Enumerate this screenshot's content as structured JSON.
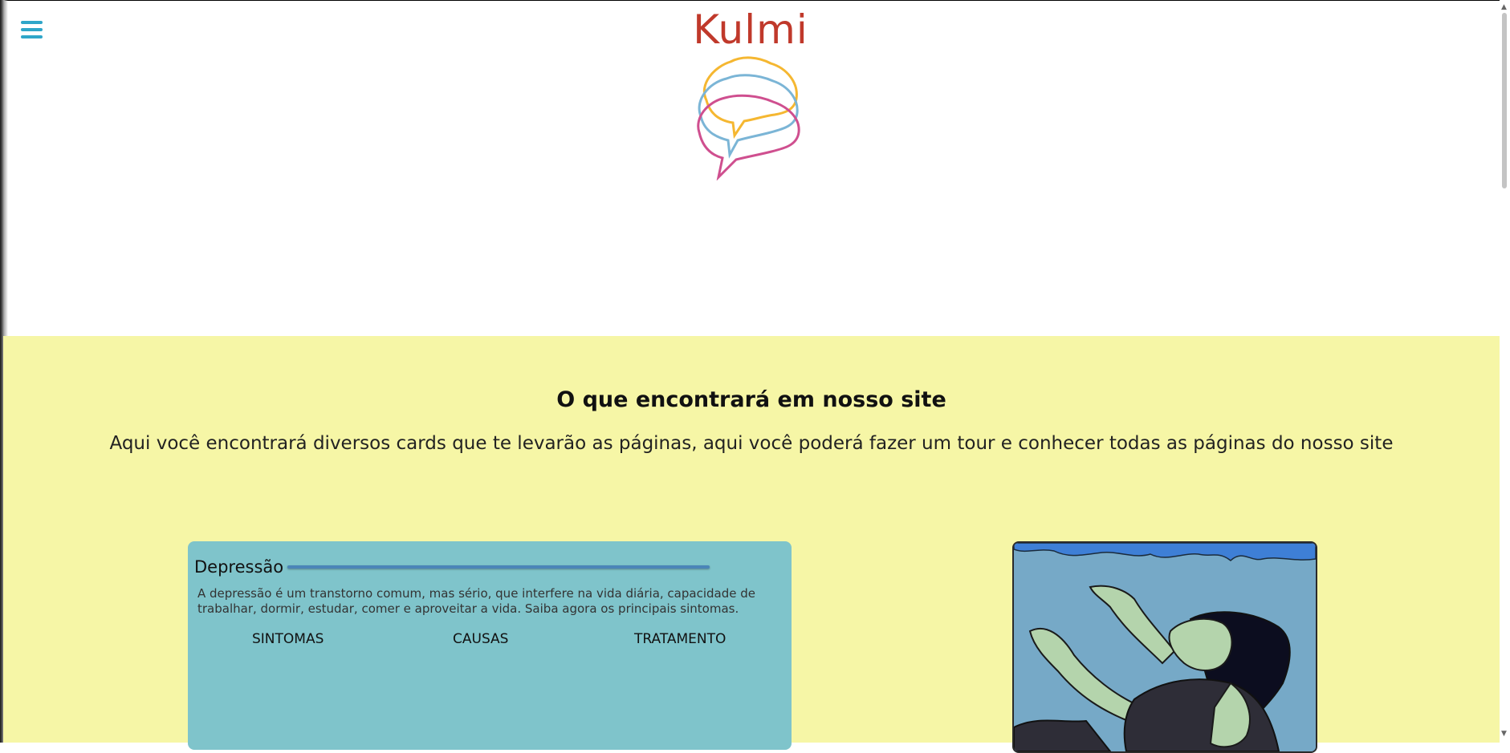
{
  "header": {
    "menu_icon": "hamburger-icon",
    "brand": "Kulmi",
    "logo_icon": "brain-speech-bubble-icon",
    "colors": {
      "brand_text": "#c0392b",
      "menu": "#2fa6c9",
      "logo_yellow": "#f5b731",
      "logo_blue": "#7bb5d6",
      "logo_pink": "#cf4f8f"
    }
  },
  "hero": {
    "title": "O que encontrará em nosso site",
    "subtitle": "Aqui você encontrará diversos cards que te levarão as páginas, aqui você poderá fazer um tour e conhecer todas as páginas do nosso site",
    "background": "#f6f6a6"
  },
  "card": {
    "title": "Depressão",
    "description": "A depressão é um transtorno comum, mas sério, que interfere na vida diária, capacidade de trabalhar, dormir, estudar, comer e aproveitar a vida. Saiba agora os principais sintomas.",
    "links": [
      "SINTOMAS",
      "CAUSAS",
      "TRATAMENTO"
    ],
    "background": "#7fc4cb"
  },
  "illustration": {
    "icon": "woman-reaching-illustration"
  }
}
